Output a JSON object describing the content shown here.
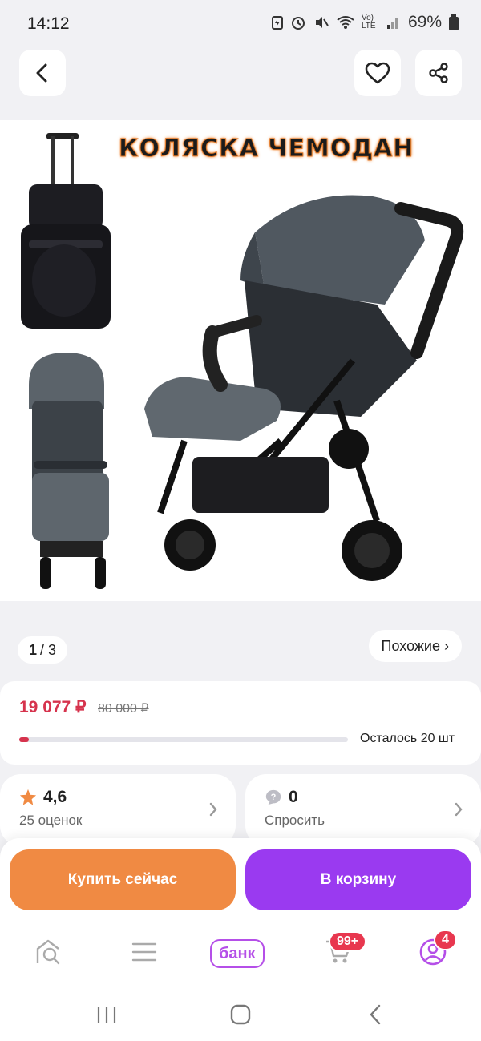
{
  "status_bar": {
    "time": "14:12",
    "network": "Vo) LTE",
    "battery": "69%"
  },
  "gallery": {
    "caption": "КОЛЯСКА ЧЕМОДАН",
    "current_page": "1",
    "total_pages": "/ 3"
  },
  "similar": {
    "label": "Похожие ›"
  },
  "price": {
    "current": "19 077 ₽",
    "old": "80 000 ₽",
    "stock_text": "Осталось 20 шт",
    "stock_fraction": 0.03
  },
  "rating": {
    "value": "4,6",
    "count_text": "25 оценок"
  },
  "questions": {
    "value": "0",
    "label": "Спросить"
  },
  "actions": {
    "buy_now": "Купить сейчас",
    "add_to_cart": "В корзину"
  },
  "bottom_nav": {
    "bank_label": "банк",
    "cart_badge": "99+",
    "profile_badge": "4"
  },
  "colors": {
    "accent_price": "#d6334d",
    "buy_button": "#f08a43",
    "cart_button": "#9a3af0",
    "brand": "#b54fe8"
  },
  "icons": [
    "back-icon",
    "heart-icon",
    "share-icon",
    "star-icon",
    "question-icon",
    "home-search-icon",
    "catalog-icon",
    "cart-icon",
    "profile-icon"
  ]
}
